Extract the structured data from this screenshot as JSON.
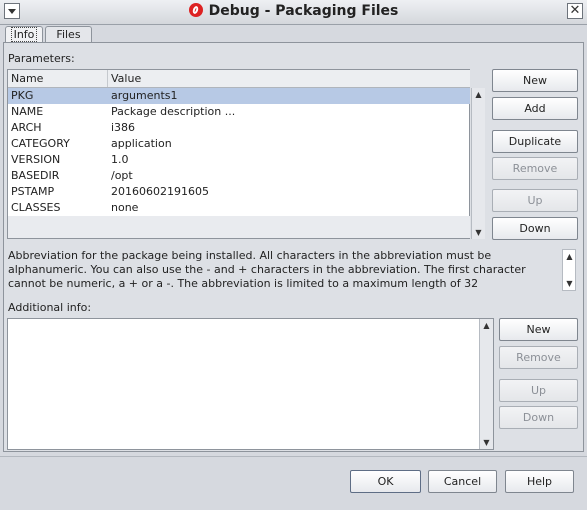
{
  "window": {
    "title": "Debug - Packaging Files"
  },
  "tabs": [
    {
      "label": "Info"
    },
    {
      "label": "Files"
    }
  ],
  "parameters": {
    "label": "Parameters:",
    "columns": [
      "Name",
      "Value"
    ],
    "rows": [
      {
        "name": "PKG",
        "value": "arguments1"
      },
      {
        "name": "NAME",
        "value": "Package description ..."
      },
      {
        "name": "ARCH",
        "value": "i386"
      },
      {
        "name": "CATEGORY",
        "value": "application"
      },
      {
        "name": "VERSION",
        "value": "1.0"
      },
      {
        "name": "BASEDIR",
        "value": "/opt"
      },
      {
        "name": "PSTAMP",
        "value": "20160602191605"
      },
      {
        "name": "CLASSES",
        "value": "none"
      }
    ],
    "selected_row": 0,
    "buttons": {
      "new": "New",
      "add": "Add",
      "duplicate": "Duplicate",
      "remove": "Remove",
      "up": "Up",
      "down": "Down"
    }
  },
  "description": {
    "lines": [
      "Abbreviation for the package being installed. All  characters in the abbreviation must be",
      "alphanumeric. You can also use the - and + characters in the abbreviation. The first character",
      "cannot be numeric, a + or a -. The abbreviation is limited to a maximum  length  of  32"
    ]
  },
  "additional": {
    "label": "Additional info:",
    "value": "",
    "buttons": {
      "new": "New",
      "remove": "Remove",
      "up": "Up",
      "down": "Down"
    }
  },
  "dialog_buttons": {
    "ok": "OK",
    "cancel": "Cancel",
    "help": "Help"
  }
}
